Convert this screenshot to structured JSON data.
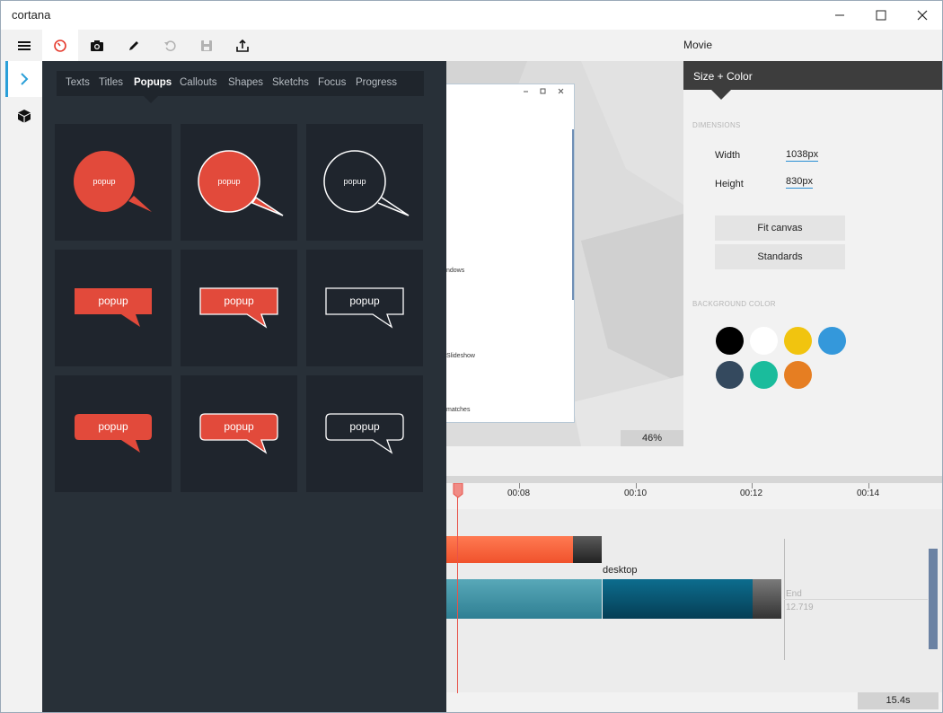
{
  "window": {
    "title": "cortana"
  },
  "toolbar": {
    "document_title": "Movie"
  },
  "popups_panel": {
    "tabs": [
      "Texts",
      "Titles",
      "Popups",
      "Callouts",
      "Shapes",
      "Sketchs",
      "Focus",
      "Progress"
    ],
    "active_tab": "Popups",
    "tiles": [
      {
        "shape": "round-bubble-filled",
        "label": "popup"
      },
      {
        "shape": "round-bubble-filled-outlined",
        "label": "popup"
      },
      {
        "shape": "round-bubble-outline",
        "label": "popup"
      },
      {
        "shape": "rect-callout-filled",
        "label": "popup"
      },
      {
        "shape": "rect-callout-filled-outlined",
        "label": "popup"
      },
      {
        "shape": "rect-callout-outline",
        "label": "popup"
      },
      {
        "shape": "rounded-callout-filled",
        "label": "popup"
      },
      {
        "shape": "rounded-callout-filled-outlined",
        "label": "popup"
      },
      {
        "shape": "rounded-callout-outline",
        "label": "popup"
      }
    ],
    "accent_color": "#e24a3b"
  },
  "preview": {
    "texts": [
      "ndows",
      "Slideshow",
      "matches"
    ],
    "zoom": "46%"
  },
  "size_color_panel": {
    "header": "Size + Color",
    "dimensions_label": "DIMENSIONS",
    "width_label": "Width",
    "width_value": "1038px",
    "height_label": "Height",
    "height_value": "830px",
    "fit_canvas_label": "Fit canvas",
    "standards_label": "Standards",
    "background_color_label": "BACKGROUND COLOR",
    "colors": [
      "#000000",
      "#ffffff",
      "#f1c40f",
      "#3498db",
      "#34495e",
      "#1abc9c",
      "#e67e22"
    ]
  },
  "timeline": {
    "ticks": [
      "00:08",
      "00:10",
      "00:12",
      "00:14"
    ],
    "clip_label": "desktop",
    "end_label": "End",
    "end_value": "12.719",
    "duration": "15.4s"
  }
}
